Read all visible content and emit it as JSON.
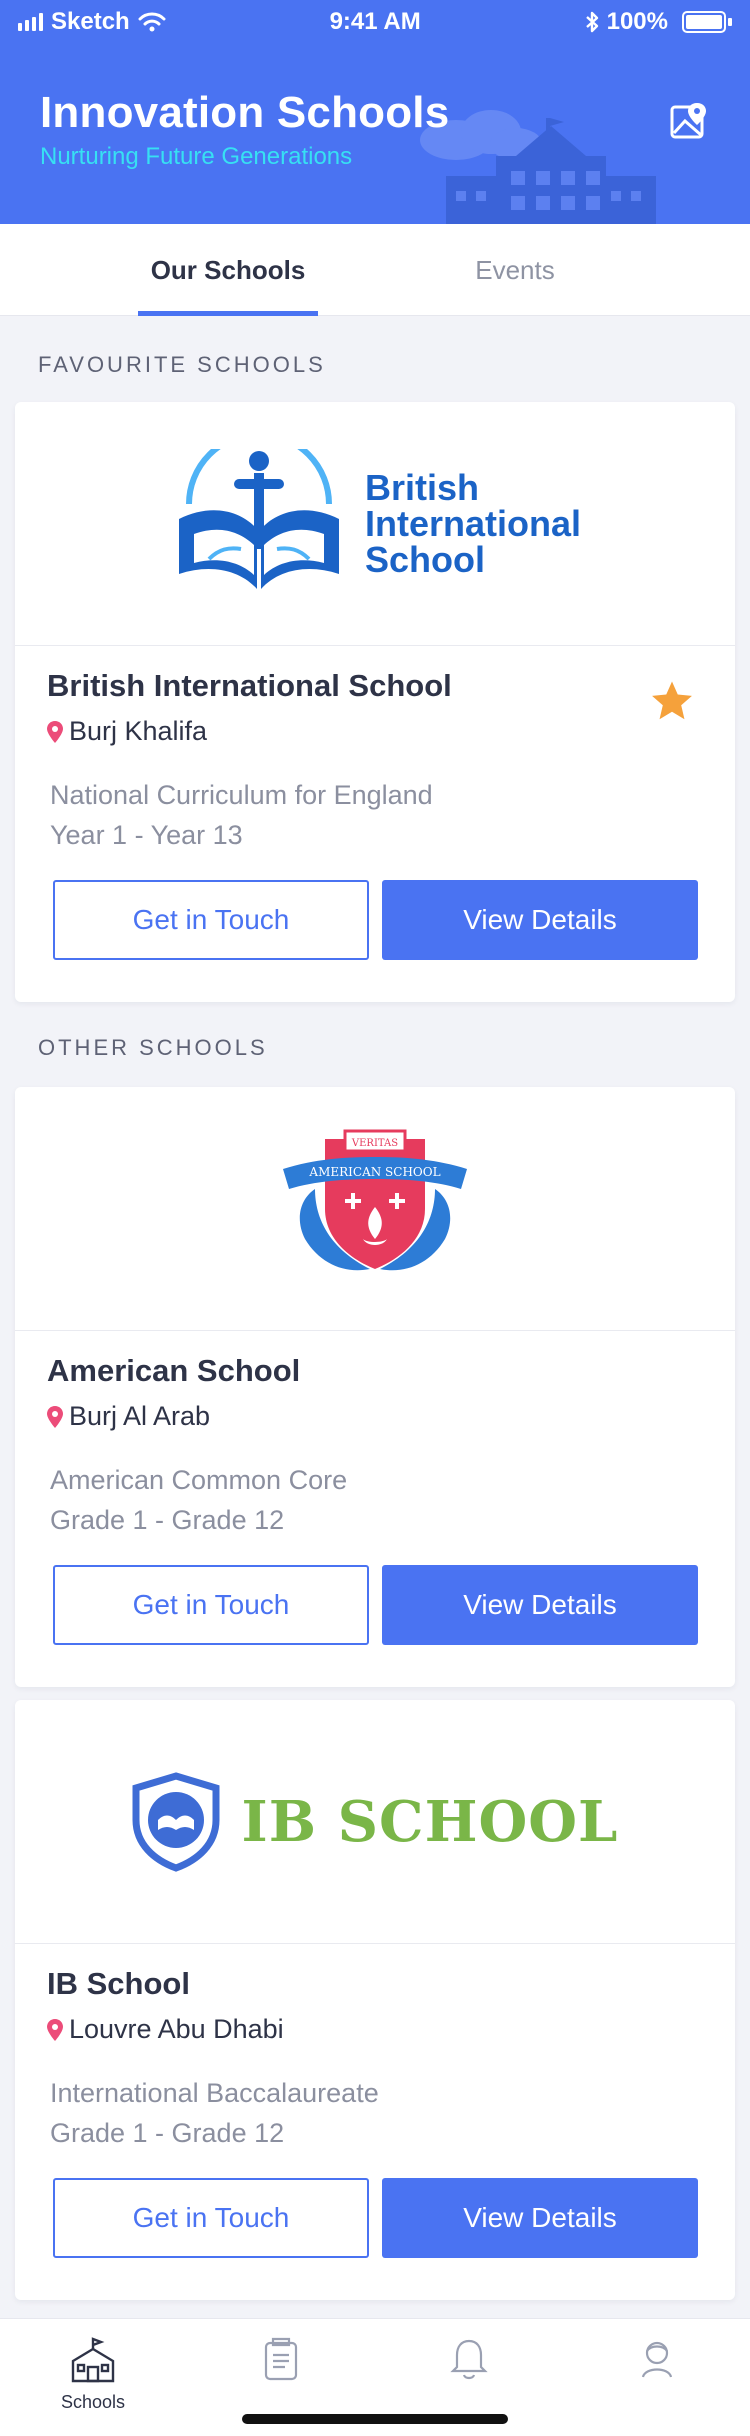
{
  "status_bar": {
    "carrier": "Sketch",
    "time": "9:41 AM",
    "battery": "100%"
  },
  "header": {
    "title": "Innovation Schools",
    "subtitle": "Nurturing Future Generations",
    "map_icon": "map-pin-icon"
  },
  "tabs": [
    {
      "label": "Our Schools",
      "active": true
    },
    {
      "label": "Events",
      "active": false
    }
  ],
  "sections": {
    "favourite": "FAVOURITE SCHOOLS",
    "other": "OTHER SCHOOLS"
  },
  "schools": [
    {
      "name": "British International School",
      "location": "Burj Khalifa",
      "curriculum": "National Curriculum for England",
      "grades": "Year 1 - Year 13",
      "favourite": true,
      "logo": {
        "text_lines": [
          "British",
          "International",
          "School"
        ],
        "color": "#1B63C6",
        "accent": "#1E88E5"
      }
    },
    {
      "name": "American School",
      "location": "Burj Al Arab",
      "curriculum": "American Common Core",
      "grades": "Grade 1 - Grade 12",
      "favourite": false,
      "logo": {
        "banner_top": "VERITAS",
        "banner": "AMERICAN SCHOOL",
        "shield_color": "#E63B5D",
        "leaf_color": "#2D7CD6"
      }
    },
    {
      "name": "IB School",
      "location": "Louvre Abu Dhabi",
      "curriculum": "International Baccalaureate",
      "grades": "Grade 1 - Grade 12",
      "favourite": false,
      "logo": {
        "text": "IB SCHOOL",
        "text_color": "#7AB648",
        "shield_color": "#3E6CD5"
      }
    }
  ],
  "actions": {
    "get_in_touch": "Get in Touch",
    "view_details": "View Details"
  },
  "bottom_nav": [
    {
      "label": "Schools",
      "icon": "school-icon",
      "active": true
    },
    {
      "label": "",
      "icon": "document-icon",
      "active": false
    },
    {
      "label": "",
      "icon": "bell-icon",
      "active": false
    },
    {
      "label": "",
      "icon": "profile-icon",
      "active": false
    }
  ],
  "colors": {
    "primary": "#4A73F2",
    "subtitle": "#37E0F3",
    "pin": "#EC4C79",
    "star": "#F5A13B"
  }
}
